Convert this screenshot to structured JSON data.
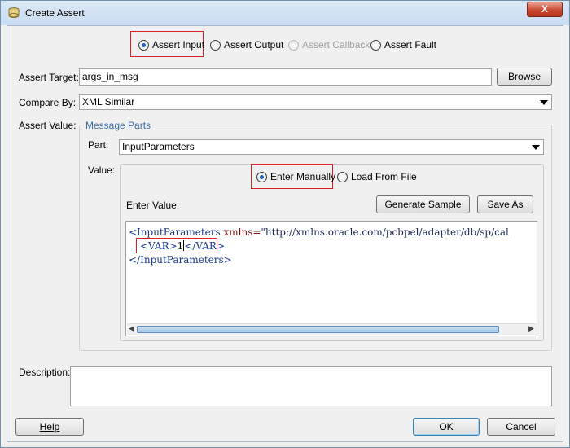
{
  "window": {
    "title": "Create Assert",
    "close_glyph": "X",
    "icon": "assert-icon"
  },
  "assert_type": {
    "options": [
      {
        "label": "Assert Input",
        "selected": true,
        "enabled": true
      },
      {
        "label": "Assert Output",
        "selected": false,
        "enabled": true
      },
      {
        "label": "Assert Callback",
        "selected": false,
        "enabled": false
      },
      {
        "label": "Assert Fault",
        "selected": false,
        "enabled": true
      }
    ]
  },
  "assert_target": {
    "label": "Assert Target:",
    "value": "args_in_msg",
    "browse_label": "Browse"
  },
  "compare_by": {
    "label": "Compare By:",
    "value": "XML Similar"
  },
  "assert_value": {
    "label": "Assert Value:",
    "group_title": "Message Parts",
    "part_label": "Part:",
    "part_value": "InputParameters",
    "value_label": "Value:",
    "mode_options": [
      {
        "label": "Enter Manually",
        "selected": true
      },
      {
        "label": "Load From File",
        "selected": false
      }
    ],
    "enter_value_label": "Enter Value:",
    "generate_sample_label": "Generate Sample",
    "save_as_label": "Save As",
    "xml": {
      "line1": {
        "open": "<InputParameters",
        "attr": " xmlns=",
        "val": "\"http://xmlns.oracle.com/pcbpel/adapter/db/sp/cal"
      },
      "line2": {
        "open": "<VAR>",
        "text": "1",
        "close": "</VAR>"
      },
      "line3": "</InputParameters>"
    }
  },
  "description": {
    "label": "Description:",
    "value": ""
  },
  "footer": {
    "help_label": "Help",
    "ok_label": "OK",
    "cancel_label": "Cancel"
  },
  "colors": {
    "highlight_box": "#d82020",
    "xml_tag": "#1a3a8c",
    "xml_attr": "#7a1010",
    "group_title": "#3b6aa0"
  }
}
